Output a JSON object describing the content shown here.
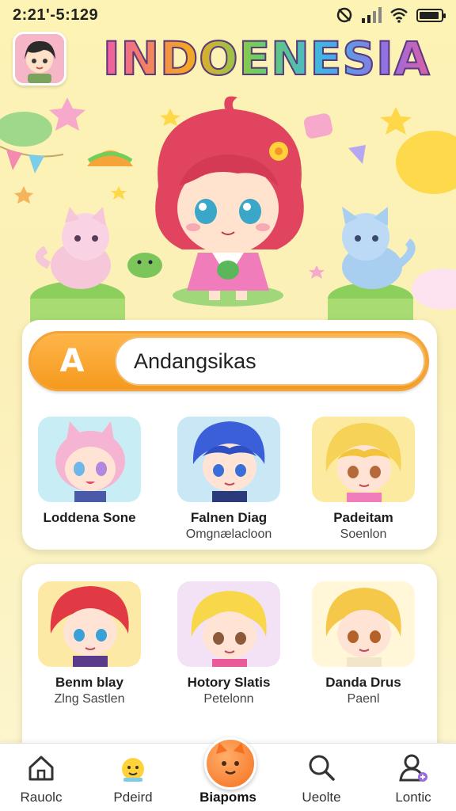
{
  "status_bar": {
    "time": "2:21'-5:129"
  },
  "header": {
    "title": "INDOENESIA"
  },
  "search": {
    "letter": "A",
    "value": "Andangsikas"
  },
  "featured": [
    {
      "title": "Loddena Sone",
      "subtitle": ""
    },
    {
      "title": "Falnen Diag",
      "subtitle": "Omgnælacloon"
    },
    {
      "title": "Padeitam",
      "subtitle": "Soenlon"
    }
  ],
  "list": [
    {
      "title": "Benm blay",
      "subtitle": "Zlng Sastlen"
    },
    {
      "title": "Hotory Slatis",
      "subtitle": "Petelonn"
    },
    {
      "title": "Danda Drus",
      "subtitle": "Paenl"
    }
  ],
  "nav": [
    {
      "label": "Rauolc",
      "icon": "home-icon"
    },
    {
      "label": "Pdeird",
      "icon": "buddy-icon"
    },
    {
      "label": "Biapoms",
      "icon": "pet-icon"
    },
    {
      "label": "Ueolte",
      "icon": "search-icon"
    },
    {
      "label": "Lontic",
      "icon": "profile-icon"
    }
  ],
  "colors": {
    "accent": "#f59a1e",
    "background": "#fcf3b4",
    "title_outline": "#5a3a7a"
  }
}
